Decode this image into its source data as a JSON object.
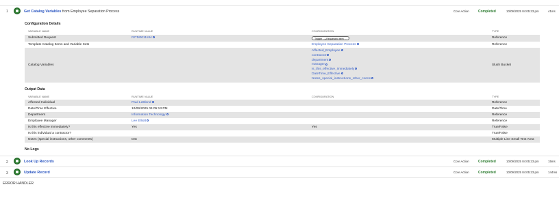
{
  "steps": [
    {
      "number": "1",
      "title": "Get Catalog Variables",
      "from_text": "from Employee Separation Process",
      "type": "Core Action",
      "status": "Completed",
      "timestamp": "10/09/2025 04:05:23 pm",
      "duration": "41ms"
    },
    {
      "number": "2",
      "title": "Look Up Records",
      "type": "Core Action",
      "status": "Completed",
      "timestamp": "10/09/2025 04:05:23 pm",
      "duration": "15ms"
    },
    {
      "number": "3",
      "title": "Update Record",
      "type": "Core Action",
      "status": "Completed",
      "timestamp": "10/09/2025 04:05:23 pm",
      "duration": "144ms"
    }
  ],
  "config": {
    "title": "Configuration Details",
    "headers": [
      "VARIABLE NAME",
      "RUNTIME VALUE",
      "CONFIGURATION",
      "TYPE"
    ],
    "rows": [
      {
        "name": "Submitted Request",
        "runtime": "RITM0011184",
        "pill_left": "Trigger ...",
        "pill_right": "Requested Item ...",
        "type": "Reference"
      },
      {
        "name": "Template Catalog Items and Variable Sets",
        "config": "Employee Separation Process",
        "type": "Reference"
      },
      {
        "name": "Catalog Variables",
        "type": "Slush Bucket",
        "config_list": [
          "Affected_Employee",
          "contractor",
          "department",
          "manager",
          "is_this_effective_immediately",
          "DateTime_Effective",
          "Notes_special_instructions_other_comm"
        ]
      }
    ]
  },
  "output": {
    "title": "Output Data",
    "headers": [
      "VARIABLE NAME",
      "RUNTIME VALUE",
      "CONFIGURATION",
      "TYPE"
    ],
    "rows": [
      {
        "name": "Affected Individual",
        "runtime": "Paul LeBlond",
        "runtime_link": true,
        "config": "",
        "type": "Reference"
      },
      {
        "name": "Date/Time Effective",
        "runtime": "10/09/2025 04:05:13 PM",
        "runtime_link": false,
        "config": "",
        "type": "Date/Time"
      },
      {
        "name": "Department",
        "runtime": "Information Technology",
        "runtime_link": true,
        "config": "",
        "type": "Reference"
      },
      {
        "name": "Employee Manager",
        "runtime": "Lee Elliott",
        "runtime_link": true,
        "config": "",
        "type": "Reference"
      },
      {
        "name": "Is this effective immediately?",
        "runtime": "Yes",
        "runtime_link": false,
        "config": "Yes",
        "type": "True/False"
      },
      {
        "name": "Is this individual a contractor?",
        "runtime": "",
        "runtime_link": false,
        "config": "",
        "type": "True/False"
      },
      {
        "name": "Notes (special instructions, other comments)",
        "runtime": "test",
        "runtime_link": false,
        "config": "",
        "type": "Multiple Line Small Text Area"
      }
    ]
  },
  "logs": {
    "title": "No Logs"
  },
  "footer": {
    "label": "ERROR HANDLER"
  },
  "colors": {
    "accent_link": "#3b63c9",
    "status_green": "#2e7d32",
    "row_shade": "#e4e4e4"
  }
}
